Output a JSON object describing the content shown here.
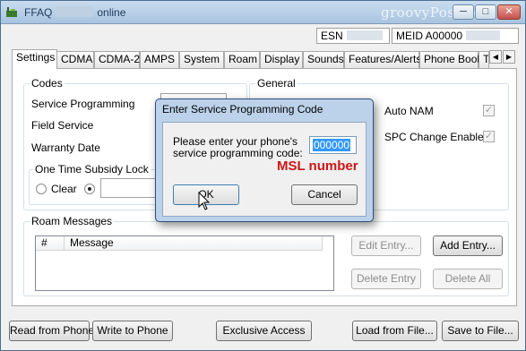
{
  "window": {
    "title_prefix": "FFAQ",
    "title_suffix": "online",
    "watermark": "groovyPost.com",
    "minimize_glyph": "─",
    "maximize_glyph": "□",
    "close_glyph": "✕"
  },
  "header": {
    "esn_label": "ESN",
    "meid_label": "MEID A00000"
  },
  "tabs": [
    "Settings",
    "CDMA",
    "CDMA-2",
    "AMPS",
    "System",
    "Roam",
    "Display",
    "Sounds",
    "Features/Alerts",
    "Phone Book",
    "T"
  ],
  "tab_scroll": {
    "left": "◀",
    "right": "▶"
  },
  "codes": {
    "title": "Codes",
    "service_programming": "Service Programming",
    "field_service": "Field Service",
    "warranty_date": "Warranty Date",
    "subsidy_title": "One Time Subsidy Lock",
    "clear_label": "Clear"
  },
  "general": {
    "title": "General",
    "auto_nam": "Auto NAM",
    "spc_change": "SPC Change Enabled",
    "check_glyph": "✓"
  },
  "roam_messages": {
    "title": "Roam Messages",
    "columns": [
      "#",
      "Message"
    ],
    "edit_entry": "Edit Entry...",
    "add_entry": "Add Entry...",
    "delete_entry": "Delete Entry",
    "delete_all": "Delete All"
  },
  "bottom_buttons": {
    "read_from_phone": "Read from Phone",
    "write_to_phone": "Write to Phone",
    "exclusive_access": "Exclusive Access",
    "load_from_file": "Load from File...",
    "save_to_file": "Save to File..."
  },
  "dialog": {
    "title": "Enter Service Programming Code",
    "prompt_line1": "Please enter your phone's",
    "prompt_line2": "service programming code:",
    "code_value": "000000",
    "annotation": "MSL number",
    "ok_label": "OK",
    "cancel_label": "Cancel"
  },
  "colors": {
    "annotation_red": "#cc1616",
    "selection_blue": "#3399ff",
    "dialog_frame": "#bcd2ea"
  }
}
